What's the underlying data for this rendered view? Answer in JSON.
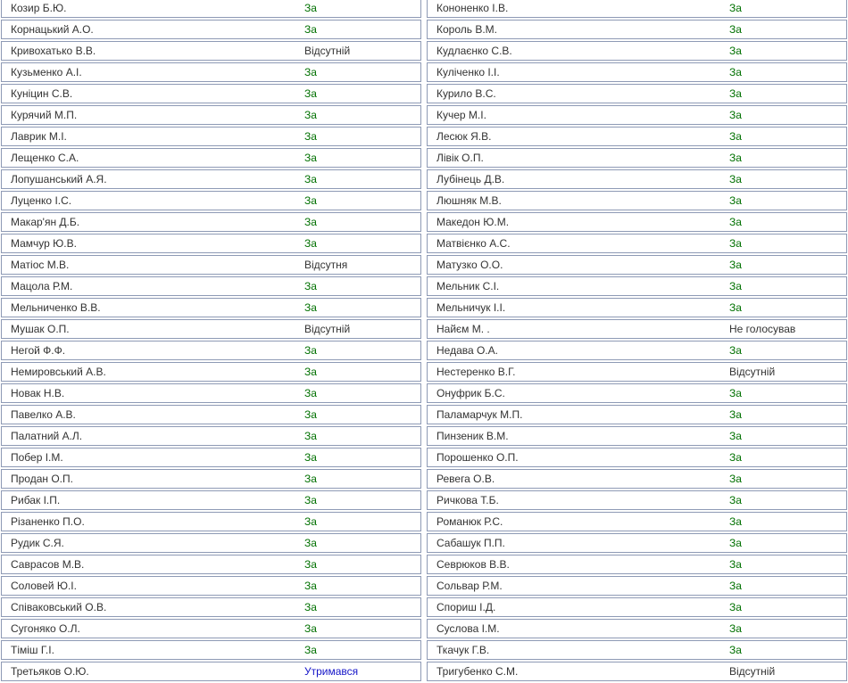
{
  "left_column": [
    {
      "name": "Козир Б.Ю.",
      "vote": "За",
      "status": "for"
    },
    {
      "name": "Корнацький А.О.",
      "vote": "За",
      "status": "for"
    },
    {
      "name": "Кривохатько В.В.",
      "vote": "Відсутній",
      "status": "absent"
    },
    {
      "name": "Кузьменко А.І.",
      "vote": "За",
      "status": "for"
    },
    {
      "name": "Куніцин С.В.",
      "vote": "За",
      "status": "for"
    },
    {
      "name": "Курячий М.П.",
      "vote": "За",
      "status": "for"
    },
    {
      "name": "Лаврик М.І.",
      "vote": "За",
      "status": "for"
    },
    {
      "name": "Лещенко С.А.",
      "vote": "За",
      "status": "for"
    },
    {
      "name": "Лопушанський А.Я.",
      "vote": "За",
      "status": "for"
    },
    {
      "name": "Луценко І.С.",
      "vote": "За",
      "status": "for"
    },
    {
      "name": "Макар'ян Д.Б.",
      "vote": "За",
      "status": "for"
    },
    {
      "name": "Мамчур Ю.В.",
      "vote": "За",
      "status": "for"
    },
    {
      "name": "Матіос М.В.",
      "vote": "Відсутня",
      "status": "absent"
    },
    {
      "name": "Мацола Р.М.",
      "vote": "За",
      "status": "for"
    },
    {
      "name": "Мельниченко В.В.",
      "vote": "За",
      "status": "for"
    },
    {
      "name": "Мушак О.П.",
      "vote": "Відсутній",
      "status": "absent"
    },
    {
      "name": "Негой Ф.Ф.",
      "vote": "За",
      "status": "for"
    },
    {
      "name": "Немировський А.В.",
      "vote": "За",
      "status": "for"
    },
    {
      "name": "Новак Н.В.",
      "vote": "За",
      "status": "for"
    },
    {
      "name": "Павелко А.В.",
      "vote": "За",
      "status": "for"
    },
    {
      "name": "Палатний А.Л.",
      "vote": "За",
      "status": "for"
    },
    {
      "name": "Побер І.М.",
      "vote": "За",
      "status": "for"
    },
    {
      "name": "Продан О.П.",
      "vote": "За",
      "status": "for"
    },
    {
      "name": "Рибак І.П.",
      "vote": "За",
      "status": "for"
    },
    {
      "name": "Різаненко П.О.",
      "vote": "За",
      "status": "for"
    },
    {
      "name": "Рудик С.Я.",
      "vote": "За",
      "status": "for"
    },
    {
      "name": "Саврасов М.В.",
      "vote": "За",
      "status": "for"
    },
    {
      "name": "Соловей Ю.І.",
      "vote": "За",
      "status": "for"
    },
    {
      "name": "Співаковський О.В.",
      "vote": "За",
      "status": "for"
    },
    {
      "name": "Сугоняко О.Л.",
      "vote": "За",
      "status": "for"
    },
    {
      "name": "Тіміш Г.І.",
      "vote": "За",
      "status": "for"
    },
    {
      "name": "Третьяков О.Ю.",
      "vote": "Утримався",
      "status": "abstain"
    }
  ],
  "right_column": [
    {
      "name": "Кононенко І.В.",
      "vote": "За",
      "status": "for"
    },
    {
      "name": "Король В.М.",
      "vote": "За",
      "status": "for"
    },
    {
      "name": "Кудлаєнко С.В.",
      "vote": "За",
      "status": "for"
    },
    {
      "name": "Куліченко І.І.",
      "vote": "За",
      "status": "for"
    },
    {
      "name": "Курило В.С.",
      "vote": "За",
      "status": "for"
    },
    {
      "name": "Кучер М.І.",
      "vote": "За",
      "status": "for"
    },
    {
      "name": "Лесюк Я.В.",
      "vote": "За",
      "status": "for"
    },
    {
      "name": "Лівік О.П.",
      "vote": "За",
      "status": "for"
    },
    {
      "name": "Лубінець Д.В.",
      "vote": "За",
      "status": "for"
    },
    {
      "name": "Люшняк М.В.",
      "vote": "За",
      "status": "for"
    },
    {
      "name": "Македон Ю.М.",
      "vote": "За",
      "status": "for"
    },
    {
      "name": "Матвієнко А.С.",
      "vote": "За",
      "status": "for"
    },
    {
      "name": "Матузко О.О.",
      "vote": "За",
      "status": "for"
    },
    {
      "name": "Мельник С.І.",
      "vote": "За",
      "status": "for"
    },
    {
      "name": "Мельничук І.І.",
      "vote": "За",
      "status": "for"
    },
    {
      "name": "Найєм М. .",
      "vote": "Не голосував",
      "status": "notvoted"
    },
    {
      "name": "Недава О.А.",
      "vote": "За",
      "status": "for"
    },
    {
      "name": "Нестеренко В.Г.",
      "vote": "Відсутній",
      "status": "absent"
    },
    {
      "name": "Онуфрик Б.С.",
      "vote": "За",
      "status": "for"
    },
    {
      "name": "Паламарчук М.П.",
      "vote": "За",
      "status": "for"
    },
    {
      "name": "Пинзеник В.М.",
      "vote": "За",
      "status": "for"
    },
    {
      "name": "Порошенко О.П.",
      "vote": "За",
      "status": "for"
    },
    {
      "name": "Ревега О.В.",
      "vote": "За",
      "status": "for"
    },
    {
      "name": "Ричкова Т.Б.",
      "vote": "За",
      "status": "for"
    },
    {
      "name": "Романюк Р.С.",
      "vote": "За",
      "status": "for"
    },
    {
      "name": "Сабашук П.П.",
      "vote": "За",
      "status": "for"
    },
    {
      "name": "Севрюков В.В.",
      "vote": "За",
      "status": "for"
    },
    {
      "name": "Сольвар Р.М.",
      "vote": "За",
      "status": "for"
    },
    {
      "name": "Спориш І.Д.",
      "vote": "За",
      "status": "for"
    },
    {
      "name": "Суслова І.М.",
      "vote": "За",
      "status": "for"
    },
    {
      "name": "Ткачук Г.В.",
      "vote": "За",
      "status": "for"
    },
    {
      "name": "Тригубенко С.М.",
      "vote": "Відсутній",
      "status": "absent"
    }
  ],
  "colors": {
    "for": "#007000",
    "absent": "#333333",
    "notvoted": "#333333",
    "abstain": "#1515c8",
    "row_border": "#8e9ab5"
  }
}
